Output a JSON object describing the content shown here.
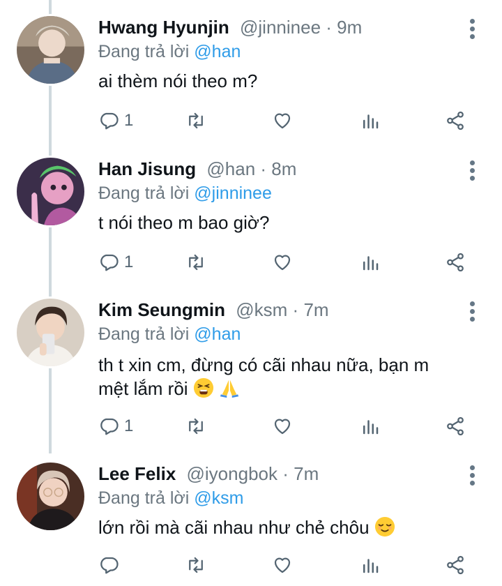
{
  "tweets": [
    {
      "name": "Hwang Hyunjin",
      "handle": "@jinninee",
      "time": "9m",
      "reply_prefix": "Đang trả lời",
      "reply_to": "@han",
      "text_lines": [
        "ai thèm nói theo m?"
      ],
      "reply_count": "1",
      "avatar_icon": "avatar-photo"
    },
    {
      "name": "Han Jisung",
      "handle": "@han",
      "time": "8m",
      "reply_prefix": "Đang trả lời",
      "reply_to": "@jinninee",
      "text_lines": [
        "t nói theo m bao giờ?"
      ],
      "reply_count": "1",
      "avatar_icon": "avatar-photo"
    },
    {
      "name": "Kim Seungmin",
      "handle": "@ksm",
      "time": "7m",
      "reply_prefix": "Đang trả lời",
      "reply_to": "@han",
      "text_lines": [
        "th t xin cm, đừng có cãi nhau nữa, bạn m",
        "mệt lắm rồi"
      ],
      "reply_count": "1",
      "avatar_icon": "avatar-photo"
    },
    {
      "name": "Lee Felix",
      "handle": "@iyongbok",
      "time": "7m",
      "reply_prefix": "Đang trả lời",
      "reply_to": "@ksm",
      "text_lines": [
        "lớn rồi mà cãi nhau như chẻ chôu"
      ],
      "reply_count": "",
      "avatar_icon": "avatar-photo"
    }
  ],
  "separator": "·",
  "colors": {
    "mention": "#2f9ce8",
    "muted": "#6b7780",
    "icon": "#536471",
    "thread_line": "#cfd9de"
  },
  "icons": [
    "reply-icon",
    "retweet-icon",
    "like-icon",
    "analytics-icon",
    "share-icon",
    "more-icon"
  ]
}
